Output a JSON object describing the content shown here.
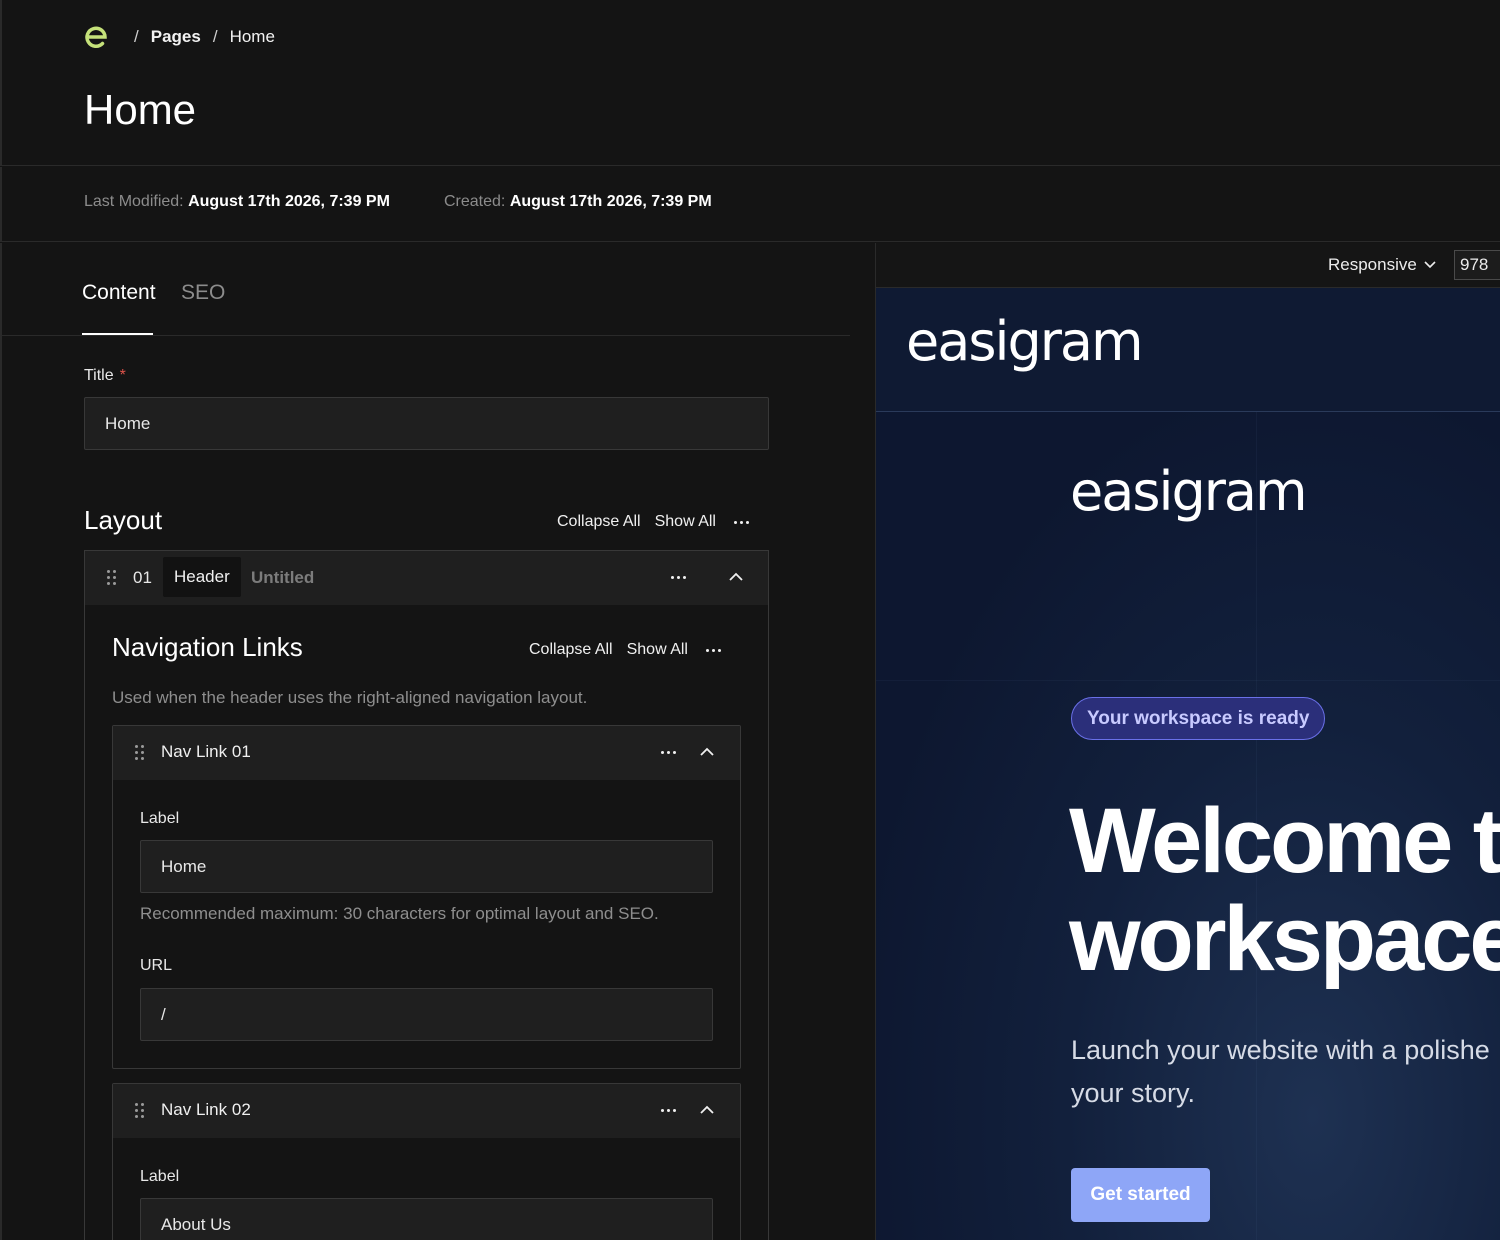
{
  "breadcrumb": {
    "sep": "/",
    "pages": "Pages",
    "current": "Home"
  },
  "page": {
    "title": "Home"
  },
  "meta": {
    "last_modified_label": "Last Modified:",
    "last_modified_value": "August 17th 2026, 7:39 PM",
    "created_label": "Created:",
    "created_value": "August 17th 2026, 7:39 PM"
  },
  "tabs": [
    {
      "label": "Content",
      "active": true
    },
    {
      "label": "SEO",
      "active": false
    }
  ],
  "title_field": {
    "label": "Title",
    "required_mark": "*",
    "value": "Home"
  },
  "layout": {
    "heading": "Layout",
    "collapse_all": "Collapse All",
    "show_all": "Show All",
    "block": {
      "number": "01",
      "type": "Header",
      "name": "Untitled",
      "nav_links": {
        "heading": "Navigation Links",
        "collapse_all": "Collapse All",
        "show_all": "Show All",
        "help": "Used when the header uses the right-aligned navigation layout.",
        "items": [
          {
            "title": "Nav Link 01",
            "label_field": "Label",
            "label_value": "Home",
            "label_help": "Recommended maximum: 30 characters for optimal layout and SEO.",
            "url_field": "URL",
            "url_value": "/"
          },
          {
            "title": "Nav Link 02",
            "label_field": "Label",
            "label_value": "About Us"
          }
        ]
      }
    }
  },
  "preview": {
    "mode": "Responsive",
    "width_value": "978",
    "nav_brand": "easigram",
    "hero_brand": "easigram",
    "badge": "Your workspace is ready",
    "headline_1": "Welcome t",
    "headline_2": "workspace",
    "lead_1": "Launch your website with a polishe",
    "lead_2": "your story.",
    "cta": "Get started"
  },
  "colors": {
    "background": "#141414",
    "logo_green": "#c5e17a",
    "preview_bg": "#0d1528",
    "badge_bg": "#2b2f7a",
    "cta_bg": "#8ea6f7",
    "required": "#e0544b"
  },
  "icons": [
    "logo-icon",
    "drag-handle-icon",
    "more-icon",
    "chevron-up-icon",
    "chevron-down-icon"
  ]
}
